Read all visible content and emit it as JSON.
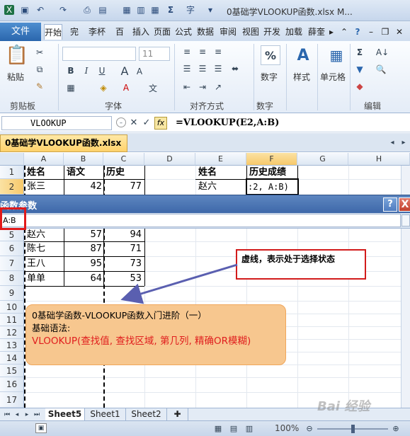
{
  "window": {
    "title": "0基础学VLOOKUP函数.xlsx M..."
  },
  "ribbon": {
    "file_tab": "文件",
    "tabs": [
      "开始",
      "页面",
      "公式",
      "数据",
      "审阅",
      "视图",
      "开发",
      "加载",
      "薛奎"
    ],
    "tabs_misc": [
      "完",
      "李杯",
      "百"
    ],
    "groups": {
      "clipboard": "剪贴板",
      "font": "字体",
      "alignment": "对齐方式",
      "number": "数字",
      "styles": "样式",
      "cells": "单元格",
      "editing": "编辑"
    },
    "paste_label": "粘贴",
    "font_size": "11",
    "number_label": "数字",
    "styles_label": "样式",
    "cells_label": "单元格"
  },
  "formula_bar": {
    "name_box": "VLOOKUP",
    "formula": "=VLOOKUP(E2,A:B)"
  },
  "document_tab": "0基础学VLOOKUP函数.xlsx",
  "columns": [
    "A",
    "B",
    "C",
    "D",
    "E",
    "F",
    "G",
    "H"
  ],
  "rows": [
    "1",
    "2",
    "5",
    "6",
    "7",
    "8",
    "9",
    "10",
    "11",
    "12",
    "13",
    "14",
    "15",
    "16",
    "17"
  ],
  "cells": {
    "A1": "姓名",
    "B1": "语文",
    "C1": "历史",
    "A2": "张三",
    "B2": "42",
    "C2": "77",
    "E1": "姓名",
    "F1": "历史成绩",
    "E2": "赵六",
    "F2": ":2, A:B)",
    "A5": "赵六",
    "B5": "57",
    "C5": "94",
    "A6": "陈七",
    "B6": "87",
    "C6": "71",
    "A7": "王八",
    "B7": "95",
    "C7": "73",
    "A8": "单单",
    "B8": "64",
    "C8": "53"
  },
  "dialog": {
    "title": "函数参数",
    "help": "?",
    "close": "X",
    "input_value": "A:B"
  },
  "callout": {
    "text": "虚线，表示处于选择状态"
  },
  "infobox": {
    "line1": "0基础学函数-VLOOKUP函数入门进阶（一）",
    "line2": "基础语法:",
    "line3": "VLOOKUP(查找值, 查找区域, 第几列, 精确OR模糊)"
  },
  "sheets": [
    "Sheet5",
    "Sheet1",
    "Sheet2"
  ],
  "status": {
    "zoom": "100%"
  },
  "watermark": "Bai 经验",
  "colors": {
    "accent_red": "#e11a1a",
    "file_tab": "#2a66ad",
    "callout_border": "#d21b1b"
  }
}
